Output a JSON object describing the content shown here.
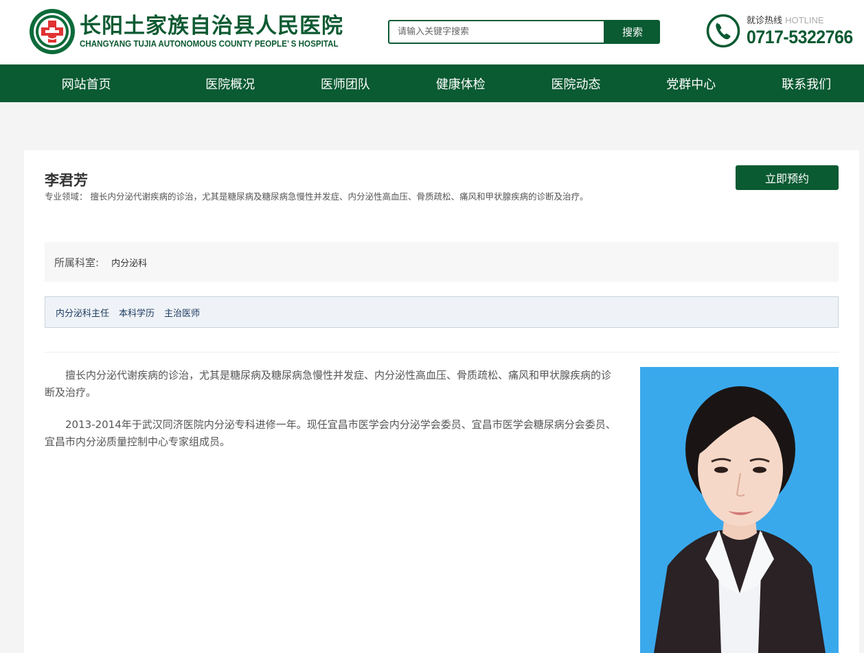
{
  "header": {
    "logo_cn": "长阳土家族自治县人民医院",
    "logo_en": "CHANGYANG TUJIA AUTONOMOUS COUNTY PEOPLE’ S HOSPITAL",
    "search_placeholder": "请输入关键字搜索",
    "search_button": "搜索",
    "hotline_label": "就诊热线",
    "hotline_label_en": "HOTLINE",
    "hotline_number": "0717-5322766"
  },
  "nav": {
    "items": [
      {
        "label": "网站首页"
      },
      {
        "label": "医院概况"
      },
      {
        "label": "医师团队"
      },
      {
        "label": "健康体检"
      },
      {
        "label": "医院动态"
      },
      {
        "label": "党群中心"
      },
      {
        "label": "联系我们"
      }
    ]
  },
  "doctor": {
    "name": "李君芳",
    "specialty_label": "专业领域：",
    "specialty": "擅长内分泌代谢疾病的诊治，尤其是糖尿病及糖尿病急慢性并发症、内分泌性高血压、骨质疏松、痛风和甲状腺疾病的诊断及治疗。",
    "book_button": "立即预约",
    "dept_label": "所属科室:",
    "dept_value": "内分泌科",
    "titles": [
      "内分泌科主任",
      "本科学历",
      "主治医师"
    ],
    "bio": [
      "擅长内分泌代谢疾病的诊治，尤其是糖尿病及糖尿病急慢性并发症、内分泌性高血压、骨质疏松、痛风和甲状腺疾病的诊断及治疗。",
      "2013-2014年于武汉同济医院内分泌专科进修一年。现任宜昌市医学会内分泌学会委员、宜昌市医学会糖尿病分会委员、宜昌市内分泌质量控制中心专家组成员。"
    ]
  },
  "colors": {
    "brand_green": "#0a5a32",
    "photo_background": "#3aa9ec"
  }
}
